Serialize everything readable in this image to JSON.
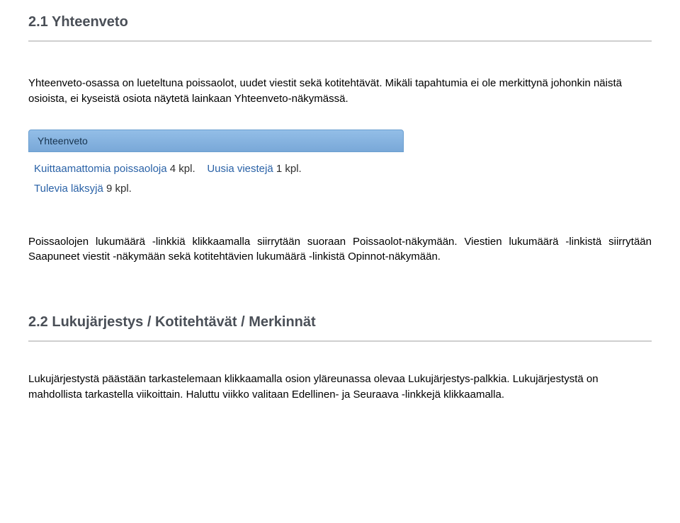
{
  "sections": {
    "s1": {
      "heading": "2.1 Yhteenveto",
      "p1": "Yhteenveto-osassa on lueteltuna poissaolot, uudet viestit sekä kotitehtävät. Mikäli tapahtumia ei ole merkittynä johonkin näistä osioista, ei kyseistä osiota näytetä lainkaan Yhteenveto-näkymässä.",
      "p2": "Poissaolojen lukumäärä -linkkiä klikkaamalla siirrytään suoraan Poissaolot-näkymään. Viestien lukumäärä -linkistä siirrytään Saapuneet viestit -näkymään sekä kotitehtävien lukumäärä -linkistä Opinnot-näkymään."
    },
    "s2": {
      "heading": "2.2 Lukujärjestys / Kotitehtävät / Merkinnät",
      "p1": "Lukujärjestystä päästään tarkastelemaan klikkaamalla osion yläreunassa olevaa Lukujärjestys-palkkia. Lukujärjestystä on mahdollista tarkastella viikoittain. Haluttu viikko valitaan Edellinen- ja Seuraava -linkkejä klikkaamalla."
    }
  },
  "panel": {
    "title": "Yhteenveto",
    "row1": {
      "absences_label": "Kuittaamattomia poissaoloja",
      "absences_count": "4 kpl.",
      "messages_label": "Uusia viestejä",
      "messages_count": "1 kpl."
    },
    "row2": {
      "upcoming_label": "Tulevia läksyjä",
      "upcoming_count": "9 kpl."
    }
  }
}
